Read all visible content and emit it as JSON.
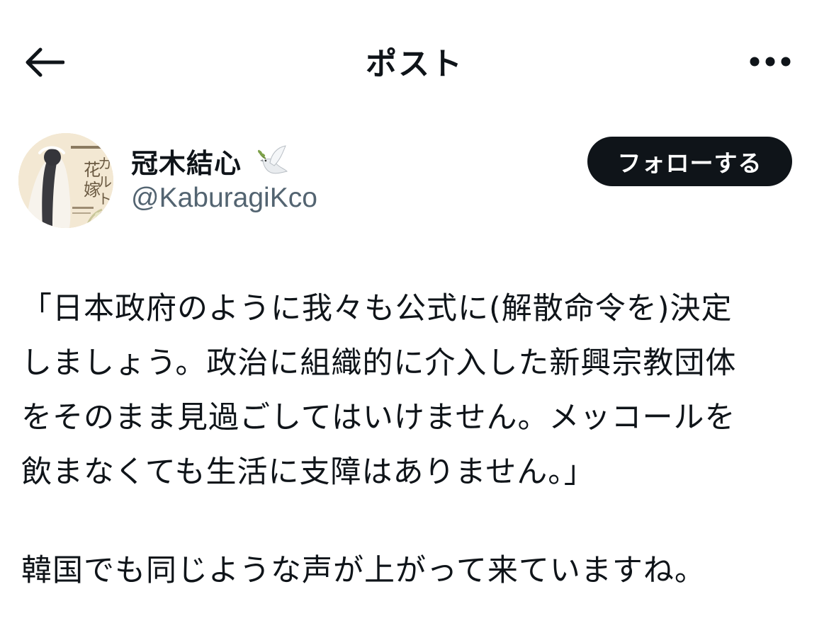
{
  "header": {
    "title": "ポスト",
    "back_icon": "arrow-left-icon",
    "more_icon": "more-horizontal-icon"
  },
  "author": {
    "display_name": "冠木結心",
    "emoji_icon": "dove-with-olive-branch-icon",
    "handle": "@KaburagiKco",
    "follow_label": "フォローする",
    "avatar_icon": "book-cover-avatar"
  },
  "post": {
    "paragraph1": "「日本政府のように我々も公式に(解散命令を)決定\nしましょう。政治に組織的に介入した新興宗教団体\nをそのまま見過ごしてはいけません。メッコールを\n飲まなくても生活に支障はありません。」",
    "paragraph2": "韓国でも同じような声が上がって来ていますね。"
  },
  "colors": {
    "text": "#0f1419",
    "secondary": "#536471",
    "button_bg": "#0f1419",
    "button_text": "#ffffff",
    "background": "#ffffff"
  }
}
